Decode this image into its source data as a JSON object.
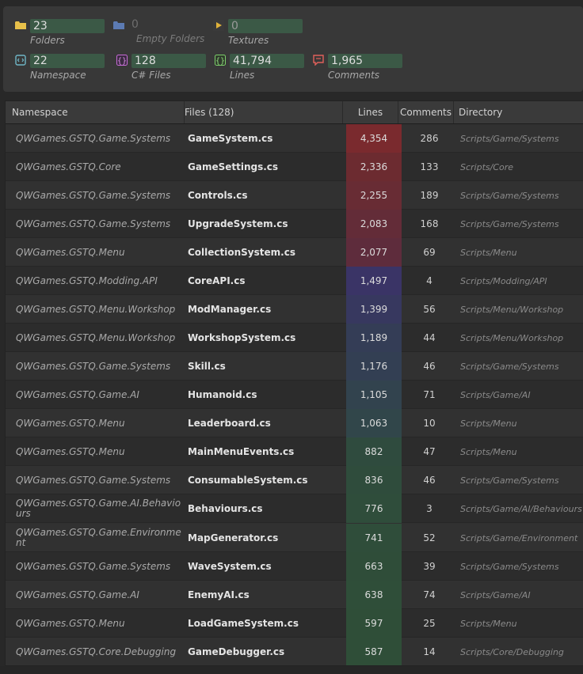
{
  "stats": {
    "folders": {
      "value": "23",
      "label": "Folders",
      "icon": "folder-icon",
      "color": "#e8c04a"
    },
    "empty_folders": {
      "value": "0",
      "label": "Empty Folders",
      "icon": "folder-icon",
      "color": "#5c7bb3"
    },
    "textures": {
      "value": "0",
      "label": "Textures",
      "icon": "texture-icon",
      "color": "#e0b23a"
    },
    "namespace": {
      "value": "22",
      "label": "Namespace",
      "icon": "namespace-icon",
      "color": "#6fb6c6"
    },
    "cs_files": {
      "value": "128",
      "label": "C# Files",
      "icon": "braces-icon",
      "color": "#c86ad8"
    },
    "lines": {
      "value": "41,794",
      "label": "Lines",
      "icon": "braces-icon",
      "color": "#7ccf6a"
    },
    "comments": {
      "value": "1,965",
      "label": "Comments",
      "icon": "comment-icon",
      "color": "#e0605a"
    }
  },
  "table": {
    "headers": {
      "namespace": "Namespace",
      "files": "Files (128)",
      "lines": "Lines",
      "comments": "Comments",
      "directory": "Directory"
    },
    "rows": [
      {
        "namespace": "QWGames.GSTQ.Game.Systems",
        "file": "GameSystem.cs",
        "lines": "4,354",
        "comments": "286",
        "directory": "Scripts/Game/Systems",
        "heat": "#7a2a2e"
      },
      {
        "namespace": "QWGames.GSTQ.Core",
        "file": "GameSettings.cs",
        "lines": "2,336",
        "comments": "133",
        "directory": "Scripts/Core",
        "heat": "#6c2b30"
      },
      {
        "namespace": "QWGames.GSTQ.Game.Systems",
        "file": "Controls.cs",
        "lines": "2,255",
        "comments": "189",
        "directory": "Scripts/Game/Systems",
        "heat": "#682c34"
      },
      {
        "namespace": "QWGames.GSTQ.Game.Systems",
        "file": "UpgradeSystem.cs",
        "lines": "2,083",
        "comments": "168",
        "directory": "Scripts/Game/Systems",
        "heat": "#632c38"
      },
      {
        "namespace": "QWGames.GSTQ.Menu",
        "file": "CollectionSystem.cs",
        "lines": "2,077",
        "comments": "69",
        "directory": "Scripts/Menu",
        "heat": "#5e2c3c"
      },
      {
        "namespace": "QWGames.GSTQ.Modding.API",
        "file": "CoreAPI.cs",
        "lines": "1,497",
        "comments": "4",
        "directory": "Scripts/Modding/API",
        "heat": "#3a3466"
      },
      {
        "namespace": "QWGames.GSTQ.Menu.Workshop",
        "file": "ModManager.cs",
        "lines": "1,399",
        "comments": "56",
        "directory": "Scripts/Menu/Workshop",
        "heat": "#37385f"
      },
      {
        "namespace": "QWGames.GSTQ.Menu.Workshop",
        "file": "WorkshopSystem.cs",
        "lines": "1,189",
        "comments": "44",
        "directory": "Scripts/Menu/Workshop",
        "heat": "#343d56"
      },
      {
        "namespace": "QWGames.GSTQ.Game.Systems",
        "file": "Skill.cs",
        "lines": "1,176",
        "comments": "46",
        "directory": "Scripts/Game/Systems",
        "heat": "#333f53"
      },
      {
        "namespace": "QWGames.GSTQ.Game.AI",
        "file": "Humanoid.cs",
        "lines": "1,105",
        "comments": "71",
        "directory": "Scripts/Game/AI",
        "heat": "#32434e"
      },
      {
        "namespace": "QWGames.GSTQ.Menu",
        "file": "Leaderboard.cs",
        "lines": "1,063",
        "comments": "10",
        "directory": "Scripts/Menu",
        "heat": "#31464a"
      },
      {
        "namespace": "QWGames.GSTQ.Menu",
        "file": "MainMenuEvents.cs",
        "lines": "882",
        "comments": "47",
        "directory": "Scripts/Menu",
        "heat": "#2f4b3e"
      },
      {
        "namespace": "QWGames.GSTQ.Game.Systems",
        "file": "ConsumableSystem.cs",
        "lines": "836",
        "comments": "46",
        "directory": "Scripts/Game/Systems",
        "heat": "#2f4c3c"
      },
      {
        "namespace": "QWGames.GSTQ.Game.AI.Behaviours",
        "file": "Behaviours.cs",
        "lines": "776",
        "comments": "3",
        "directory": "Scripts/Game/AI/Behaviours",
        "heat": "#2f4d3b"
      },
      {
        "namespace": "QWGames.GSTQ.Game.Environment",
        "file": "MapGenerator.cs",
        "lines": "741",
        "comments": "52",
        "directory": "Scripts/Game/Environment",
        "heat": "#2f4d3a"
      },
      {
        "namespace": "QWGames.GSTQ.Game.Systems",
        "file": "WaveSystem.cs",
        "lines": "663",
        "comments": "39",
        "directory": "Scripts/Game/Systems",
        "heat": "#2f4d39"
      },
      {
        "namespace": "QWGames.GSTQ.Game.AI",
        "file": "EnemyAI.cs",
        "lines": "638",
        "comments": "74",
        "directory": "Scripts/Game/AI",
        "heat": "#2f4e39"
      },
      {
        "namespace": "QWGames.GSTQ.Menu",
        "file": "LoadGameSystem.cs",
        "lines": "597",
        "comments": "25",
        "directory": "Scripts/Menu",
        "heat": "#2f4e38"
      },
      {
        "namespace": "QWGames.GSTQ.Core.Debugging",
        "file": "GameDebugger.cs",
        "lines": "587",
        "comments": "14",
        "directory": "Scripts/Core/Debugging",
        "heat": "#2f4e38"
      }
    ]
  }
}
